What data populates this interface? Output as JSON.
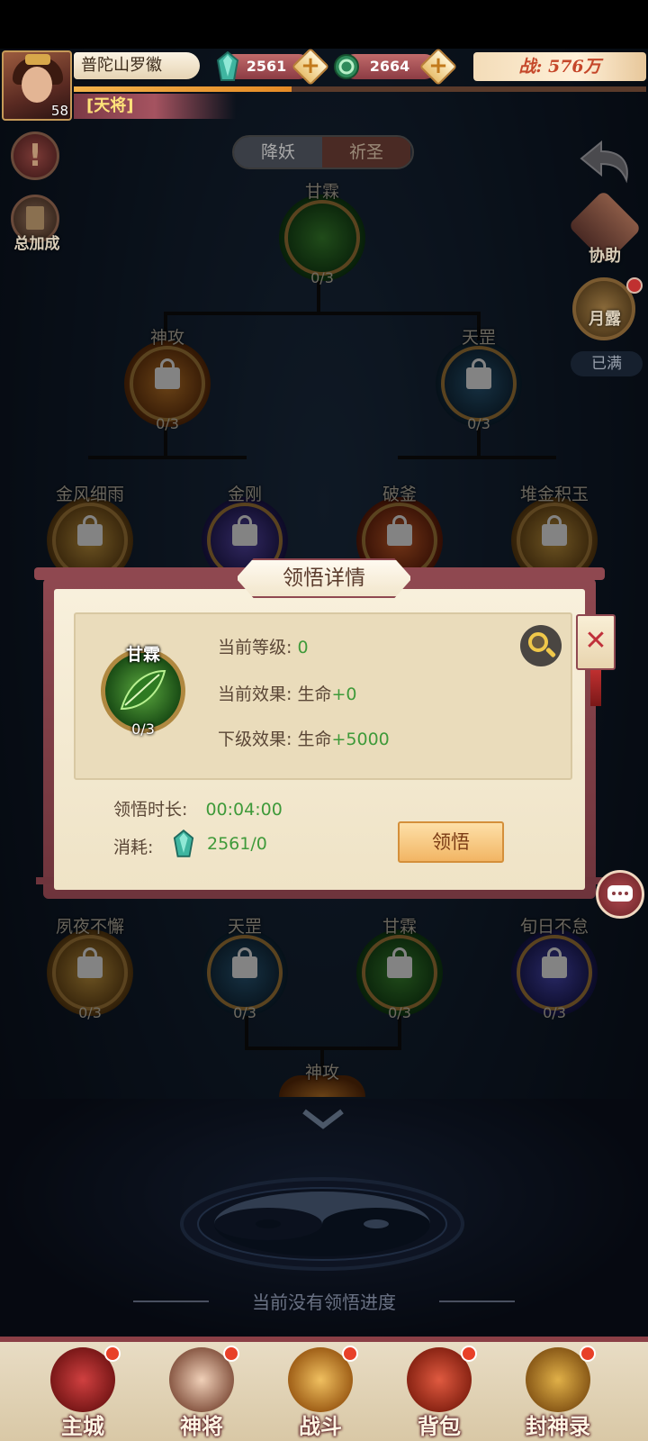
{
  "player": {
    "name": "普陀山罗徽",
    "level": "58",
    "rank": "[天将]",
    "exp_fraction": 0.38,
    "jade": "2561",
    "coins": "2664",
    "power": "战: 576万"
  },
  "tabs": {
    "left": "降妖",
    "right": "祈圣"
  },
  "left_icons": {
    "total_bonus": "总加成"
  },
  "right_icons": {
    "assist": "协助",
    "yuelu": "月露",
    "yuelu_status": "已满"
  },
  "tree": {
    "root": {
      "label": "甘霖",
      "count": "0/3"
    },
    "level2": [
      {
        "label": "神攻",
        "count": "0/3"
      },
      {
        "label": "天罡",
        "count": "0/3"
      }
    ],
    "level3": [
      {
        "label": "金风细雨"
      },
      {
        "label": "金刚"
      },
      {
        "label": "破釜"
      },
      {
        "label": "堆金积玉"
      }
    ],
    "level5": [
      {
        "label": "夙夜不懈",
        "count": "0/3"
      },
      {
        "label": "天罡",
        "count": "0/3"
      },
      {
        "label": "甘霖",
        "count": "0/3"
      },
      {
        "label": "旬日不怠",
        "count": "0/3"
      }
    ],
    "level6": {
      "label": "神攻"
    }
  },
  "popup": {
    "title": "领悟详情",
    "skill_name": "甘霖",
    "skill_count": "0/3",
    "current_level_label": "当前等级:",
    "current_level_value": "0",
    "current_effect_label": "当前效果:",
    "current_effect_prefix": "生命",
    "current_effect_value": "+0",
    "next_effect_label": "下级效果:",
    "next_effect_prefix": "生命",
    "next_effect_value": "+5000",
    "duration_label": "领悟时长:",
    "duration_value": "00:04:00",
    "cost_label": "消耗:",
    "cost_value": "2561/0",
    "learn_button": "领悟",
    "close_icon": "close-x"
  },
  "status": {
    "progress_text": "当前没有领悟进度"
  },
  "bottom_nav": [
    {
      "label": "主城"
    },
    {
      "label": "神将"
    },
    {
      "label": "战斗"
    },
    {
      "label": "背包"
    },
    {
      "label": "封神录"
    }
  ],
  "colors": {
    "accent": "#8f4850",
    "green_text": "#3f9a3a",
    "gold": "#f0c84a"
  }
}
